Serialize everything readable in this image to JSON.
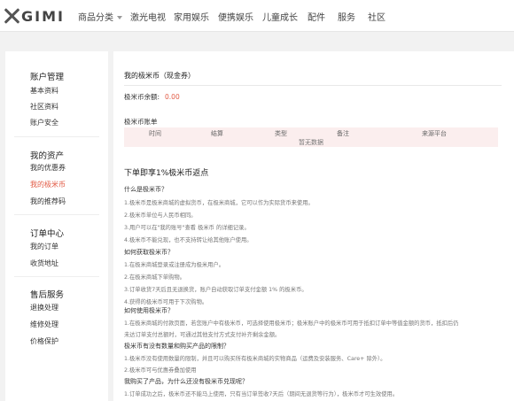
{
  "brand": {
    "logo_text": "GIMI"
  },
  "nav": {
    "items": [
      "商品分类",
      "激光电视",
      "家用娱乐",
      "便携娱乐",
      "儿童成长",
      "配件",
      "服务",
      "社区"
    ]
  },
  "sidebar": {
    "groups": [
      {
        "title": "账户管理",
        "links": [
          "基本资料",
          "社区资料",
          "账户安全"
        ]
      },
      {
        "title": "我的资产",
        "links": [
          "我的优惠券",
          "我的极米币",
          "我的推荐码"
        ]
      },
      {
        "title": "订单中心",
        "links": [
          "我的订单",
          "收货地址"
        ]
      },
      {
        "title": "售后服务",
        "links": [
          "退换处理",
          "维修处理",
          "价格保护"
        ]
      }
    ],
    "active": "我的极米币"
  },
  "main": {
    "title": "我的极米币（现金券）",
    "balance_label": "极米币余额:",
    "balance_value": "0.00",
    "bill_title": "极米币账单",
    "bill_columns": [
      "时间",
      "结算",
      "类型",
      "备注",
      "来源平台"
    ],
    "bill_empty": "暂无数据",
    "rules_title": "下单即享1%极米币返点",
    "faq": [
      {
        "q": "什么是极米币？",
        "a": [
          "1.极米币是极米商城的虚拟货币，在极米商城，它可以作为实际货币来使用。",
          "2.极米币单位与人民币相同。",
          "3.用户可以在\"我的账号\"查看 极米币 的详细记录。",
          "4.极米币不能兑现，也不支持转让给其他账户使用。"
        ]
      },
      {
        "q": "如何获取极米币？",
        "a": [
          "1.在极米商城登录或注册成为极米用户。",
          "2.在极米商城下单购物。",
          "3.订单收货7天后且无退换货，账户自动获取订单支付金额 1% 的极米币。",
          "4.获得的极米币可用于下次购物。"
        ]
      },
      {
        "q": "如何使用极米币？",
        "a": [
          "1.在极米商城的付款页面，若您账户中有极米币，可选择使用极米币；极米账户中的极米币可用于抵扣订单中等值金额的货币，抵扣后仍",
          "未达订单支付总额时，可通过其他支付方式支付补齐剩余金额。"
        ]
      },
      {
        "q": "极米币有没有数量和购买产品的限制？",
        "a": [
          "1.极米币没有使用数量的限制，并且可以购买所有极米商城的实物商品（运费及安装服务、Care+ 除外）。",
          "2.极米币可与优惠券叠加使用"
        ]
      },
      {
        "q": "我购买了产品，为什么还没有极米币兑现呢？",
        "a": [
          "1.订单成功之后，极米币还不能马上使用，只有当订单签收7天后（期间无退货等行为），极米币才可生效使用。"
        ]
      }
    ]
  },
  "colors": {
    "accent": "#e25b45",
    "table_bg": "#fbeeee"
  }
}
